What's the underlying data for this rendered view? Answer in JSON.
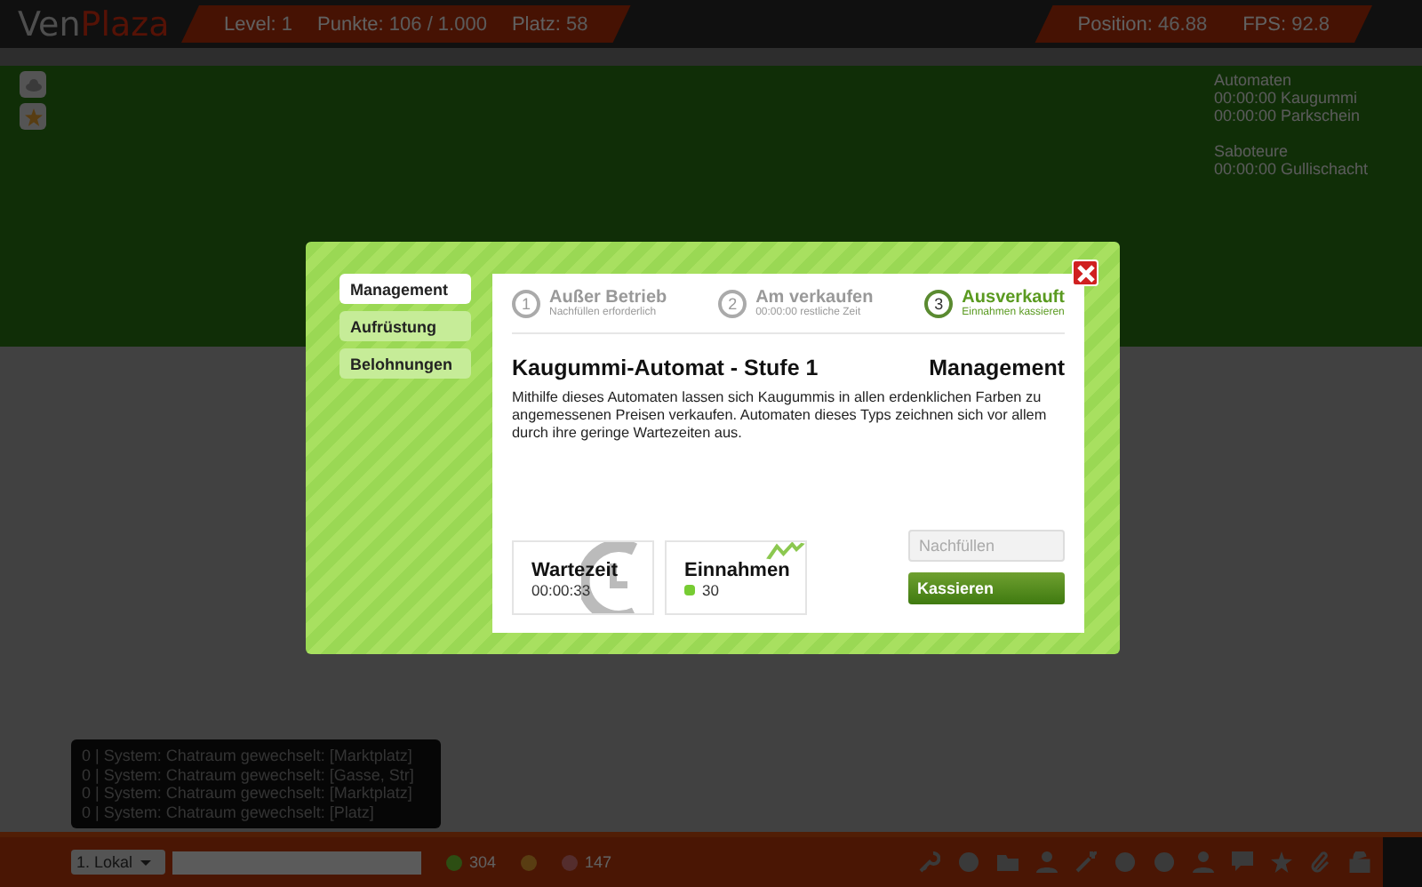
{
  "header": {
    "logo_a": "Ven",
    "logo_b": "Plaza",
    "stats": [
      {
        "label": "Level:",
        "value": "1"
      },
      {
        "label": "Punkte:",
        "value": "106 / 1.000"
      },
      {
        "label": "Platz:",
        "value": "58"
      }
    ],
    "right_stats": [
      {
        "label": "Position:",
        "value": "46.88"
      },
      {
        "label": "FPS:",
        "value": "92.8"
      }
    ]
  },
  "info": {
    "sections": [
      {
        "title": "Automaten",
        "lines": [
          "00:00:00 Kaugummi",
          "00:00:00 Parkschein"
        ]
      },
      {
        "title": "Saboteure",
        "lines": [
          "00:00:00 Gullischacht"
        ]
      }
    ]
  },
  "chat": {
    "lines": [
      "0 | System:  Chatraum gewechselt: [Marktplatz]",
      "0 | System:  Chatraum gewechselt: [Gasse, Str]",
      "0 | System:  Chatraum gewechselt: [Marktplatz]",
      "0 | System:  Chatraum gewechselt: [Platz]"
    ],
    "channel": "1. Lokal",
    "coins": "304",
    "tickets": "147"
  },
  "dialog": {
    "tabs": [
      {
        "label": "Management",
        "selected": true
      },
      {
        "label": "Aufrüstung",
        "selected": false
      },
      {
        "label": "Belohnungen",
        "selected": false
      }
    ],
    "steps": [
      {
        "number": "1",
        "title": "Außer Betrieb",
        "subtitle": "Nachfüllen erforderlich",
        "selected": false
      },
      {
        "number": "2",
        "title": "Am verkaufen",
        "subtitle": "00:00:00 restliche Zeit",
        "selected": false
      },
      {
        "number": "3",
        "title": "Ausverkauft",
        "subtitle": "Einnahmen kassieren",
        "selected": true
      }
    ],
    "title": "Kaugummi-Automat - Stufe 1",
    "section": "Management",
    "description": "Mithilfe dieses Automaten lassen sich Kaugummis in allen erdenklichen Farben zu angemessenen Preisen verkaufen. Automaten dieses Typs zeichnen sich vor allem durch ihre geringe Wartezeiten aus.",
    "wait": {
      "title": "Wartezeit",
      "value": "00:00:33"
    },
    "income": {
      "title": "Einnahmen",
      "value": "30"
    },
    "buttons": [
      {
        "label": "Nachfüllen",
        "disabled": true
      },
      {
        "label": "Kassieren",
        "disabled": false
      }
    ]
  }
}
